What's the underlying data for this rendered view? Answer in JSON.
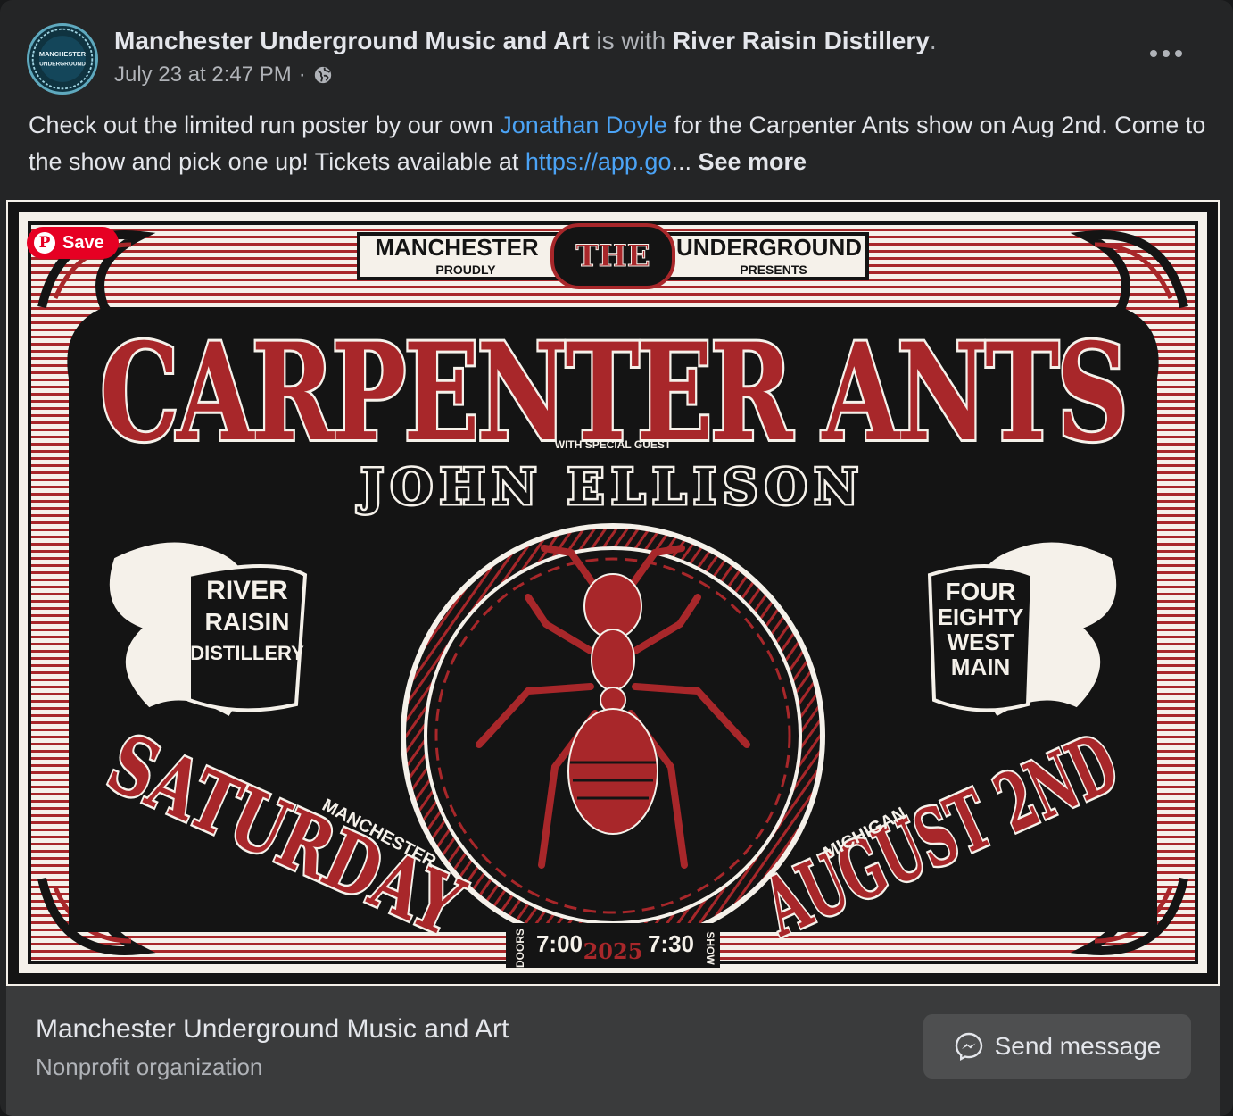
{
  "post": {
    "author": "Manchester Underground Music and Art",
    "with_text": "is with",
    "with_page": "River Raisin Distillery",
    "period": ".",
    "timestamp": "July 23 at 2:47 PM",
    "separator": "·",
    "audience_icon": "globe-icon",
    "avatar_text_1": "MANCHESTER",
    "avatar_text_2": "UNDERGROUND",
    "more_icon": "more-horizontal-icon",
    "text_1": "Check out the limited run poster by our own ",
    "mention": "Jonathan Doyle",
    "text_2": " for the Carpenter Ants show on Aug 2nd. Come to the show and pick one up! Tickets available at ",
    "link": "https://app.go",
    "ellipsis": "...",
    "see_more": "See more"
  },
  "poster": {
    "save_label": "Save",
    "presenter_left": "MANCHESTER",
    "presenter_right": "UNDERGROUND",
    "the": "THE",
    "proudly": "PROUDLY",
    "presents": "PRESENTS",
    "headliner": "CARPENTER ANTS",
    "special_guest_label": "WITH SPECIAL GUEST",
    "guest": "JOHN ELLISON",
    "venue_left_1": "RIVER",
    "venue_left_2": "RAISIN",
    "venue_left_3": "DISTILLERY",
    "venue_right_1": "FOUR",
    "venue_right_2": "EIGHTY",
    "venue_right_3": "WEST",
    "venue_right_4": "MAIN",
    "day": "SATURDAY",
    "date": "AUGUST 2ND",
    "city": "MANCHESTER",
    "state": "MICHIGAN",
    "doors_label": "DOORS",
    "doors_time": "7:00",
    "year": "2025",
    "show_time": "7:30",
    "show_label": "SHOW",
    "colors": {
      "red": "#a8272a",
      "black": "#141414",
      "cream": "#f5f1ea"
    }
  },
  "footer": {
    "page_name": "Manchester Underground Music and Art",
    "page_category": "Nonprofit organization",
    "button_label": "Send message",
    "button_icon": "messenger-icon"
  }
}
